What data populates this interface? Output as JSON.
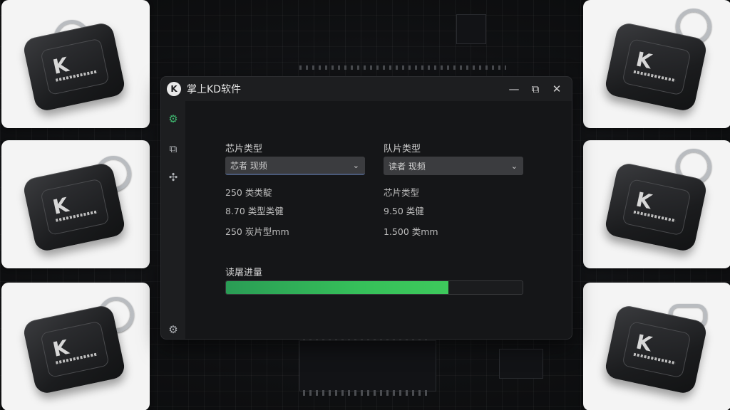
{
  "window": {
    "title": "掌上KD软件",
    "logo_letter": "K"
  },
  "controls": {
    "minimize": "—",
    "restore": "⧉",
    "close": "✕"
  },
  "sidebar": {
    "items": [
      {
        "icon": "chip-scan-icon",
        "glyph": "⚙",
        "active": true
      },
      {
        "icon": "devices-icon",
        "glyph": "⧉",
        "active": false
      },
      {
        "icon": "network-icon",
        "glyph": "✣",
        "active": false
      },
      {
        "icon": "settings-icon",
        "glyph": "⚙",
        "active": false
      }
    ]
  },
  "form": {
    "chip_type_label": "芯片类型",
    "chip_type_value": "芯者 现频",
    "model_type_label": "队片类型",
    "model_type_value": "读者 现频",
    "left_info": [
      "250 类类靛",
      "8.70 类型类健",
      "250 炭片型mm"
    ],
    "right_info": [
      "芯片类型",
      "9.50 类健",
      "1.500 类mm"
    ]
  },
  "progress": {
    "label": "读屠进量",
    "value": 0.75
  },
  "cards": {
    "logo": "K"
  },
  "colors": {
    "accent": "#36c05a",
    "window_bg": "#1d1e20",
    "content_bg": "#151618"
  }
}
